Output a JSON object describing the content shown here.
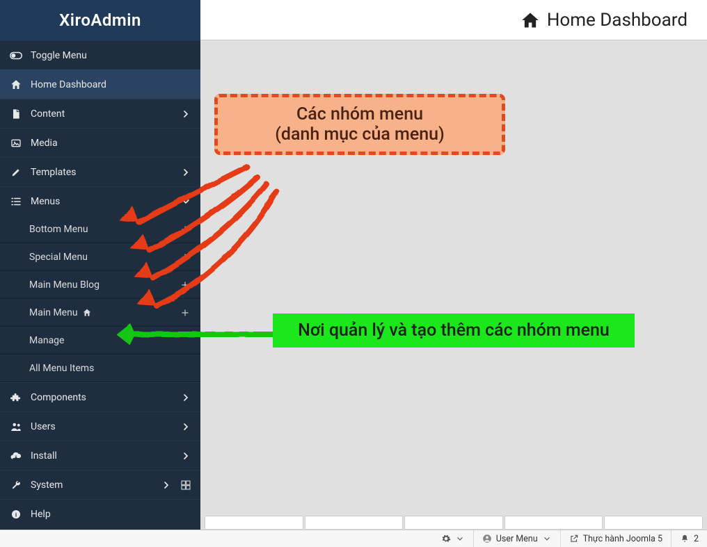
{
  "brand": "XiroAdmin",
  "header": {
    "title": "Home Dashboard"
  },
  "sidebar": {
    "toggle_label": "Toggle Menu",
    "items": [
      {
        "label": "Home Dashboard"
      },
      {
        "label": "Content"
      },
      {
        "label": "Media"
      },
      {
        "label": "Templates"
      },
      {
        "label": "Menus"
      },
      {
        "label": "Components"
      },
      {
        "label": "Users"
      },
      {
        "label": "Install"
      },
      {
        "label": "System"
      },
      {
        "label": "Help"
      }
    ],
    "menus_sub": [
      {
        "label": "Bottom Menu"
      },
      {
        "label": "Special Menu"
      },
      {
        "label": "Main Menu Blog"
      },
      {
        "label": "Main Menu"
      },
      {
        "label": "Manage"
      },
      {
        "label": "All Menu Items"
      }
    ]
  },
  "annotations": {
    "orange": "Các nhóm menu\n(danh mục của menu)",
    "green": "Nơi quản lý và tạo thêm các nhóm menu"
  },
  "status": {
    "user_menu": "User Menu",
    "site_link": "Thực hành Joomla 5",
    "notif_count": "2"
  }
}
